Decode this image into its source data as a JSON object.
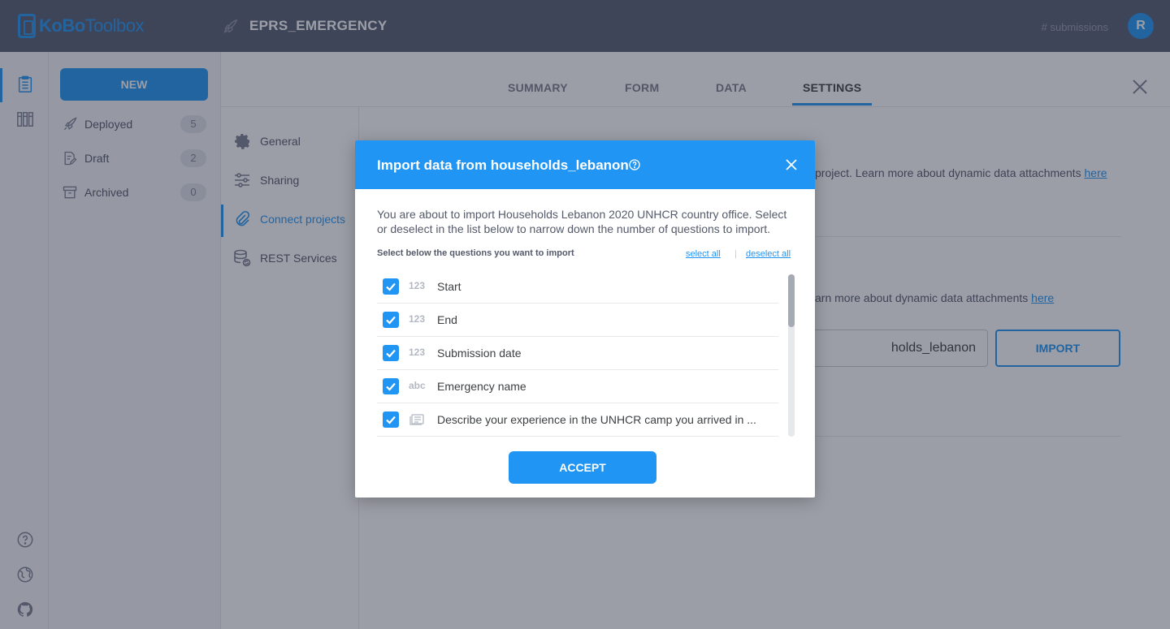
{
  "app": {
    "logo_part1": "KoBo",
    "logo_part2": "Toolbox"
  },
  "header": {
    "project_title": "EPRS_EMERGENCY",
    "submissions_label": "# submissions",
    "avatar_initial": "R"
  },
  "drawer": {
    "new_label": "NEW",
    "items": [
      {
        "label": "Deployed",
        "count": "5"
      },
      {
        "label": "Draft",
        "count": "2"
      },
      {
        "label": "Archived",
        "count": "0"
      }
    ]
  },
  "tabs": [
    {
      "label": "SUMMARY"
    },
    {
      "label": "FORM"
    },
    {
      "label": "DATA"
    },
    {
      "label": "SETTINGS",
      "active": true
    }
  ],
  "settings_nav": [
    {
      "label": "General"
    },
    {
      "label": "Sharing"
    },
    {
      "label": "Connect projects",
      "active": true
    },
    {
      "label": "REST Services"
    }
  ],
  "background": {
    "text1": "project. Learn more about dynamic data attachments ",
    "text2": "arn more about dynamic data attachments ",
    "link_here": "here",
    "input_value": "holds_lebanon",
    "import_label": "IMPORT"
  },
  "modal": {
    "title": "Import data from households_lebanon",
    "description": "You are about to import Households Lebanon 2020 UNHCR country office. Select or deselect in the list below to narrow down the number of questions to import.",
    "select_label": "Select below the questions you want to import",
    "select_all": "select all",
    "separator": "|",
    "deselect_all": "deselect all",
    "accept_label": "ACCEPT",
    "questions": [
      {
        "type": "123",
        "label": "Start",
        "checked": true
      },
      {
        "type": "123",
        "label": "End",
        "checked": true
      },
      {
        "type": "123",
        "label": "Submission date",
        "checked": true
      },
      {
        "type": "abc",
        "label": "Emergency name",
        "checked": true
      },
      {
        "type": "text-icon",
        "label": "Describe your experience in the UNHCR camp you arrived in ...",
        "checked": true
      }
    ]
  },
  "colors": {
    "accent": "#2095f3",
    "topbar": "#575d72"
  }
}
